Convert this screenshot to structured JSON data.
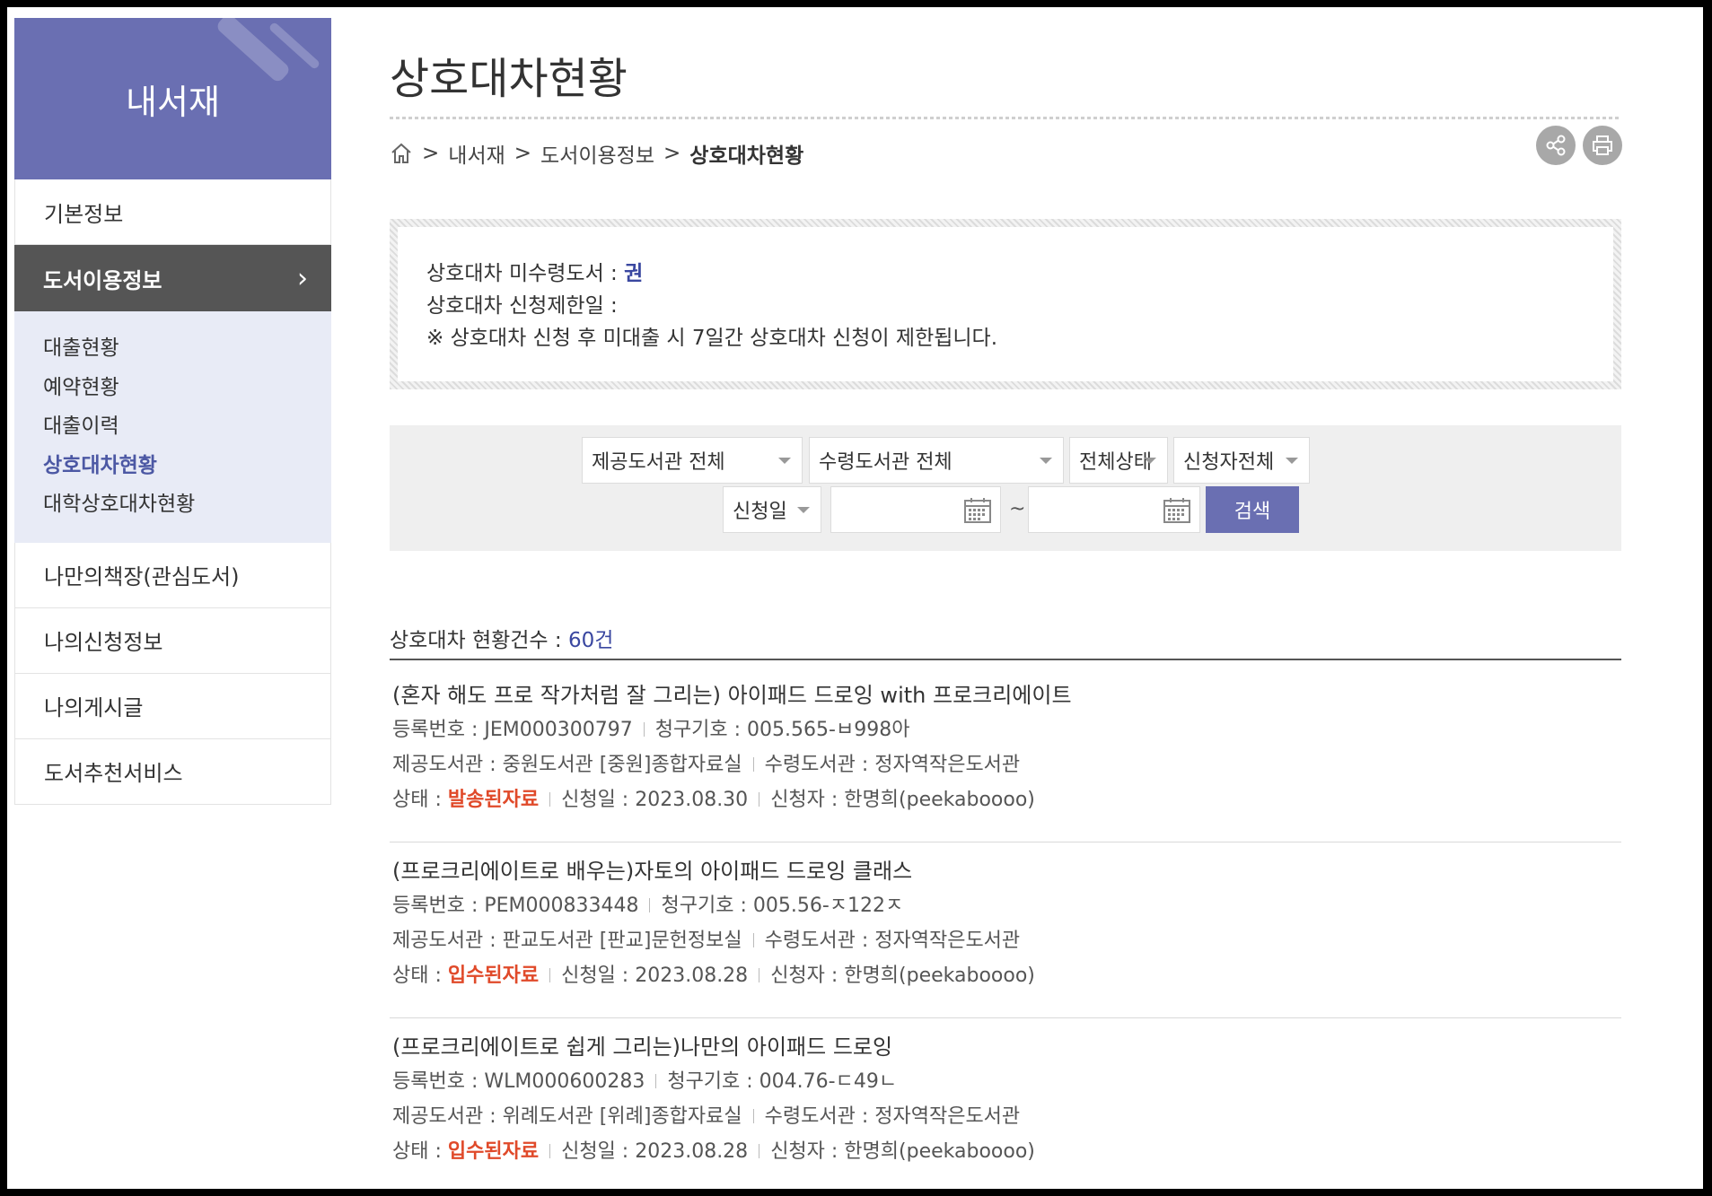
{
  "sidebar": {
    "title": "내서재",
    "items_top": [
      "기본정보"
    ],
    "active": "도서이용정보",
    "active_arrow": "›",
    "submenu": [
      "대출현황",
      "예약현황",
      "대출이력",
      "상호대차현황",
      "대학상호대차현황"
    ],
    "items_bottom": [
      "나만의책장(관심도서)",
      "나의신청정보",
      "나의게시글",
      "도서추천서비스"
    ]
  },
  "page": {
    "title": "상호대차현황",
    "breadcrumb": [
      "내서재",
      "도서이용정보",
      "상호대차현황"
    ],
    "breadcrumb_sep": ">"
  },
  "info": {
    "line1_label": "상호대차 미수령도서 : ",
    "line1_value": "권",
    "line2": "상호대차 신청제한일 :",
    "line3": "※ 상호대차 신청 후 미대출 시 7일간 상호대차 신청이 제한됩니다."
  },
  "search": {
    "provider_lib": "제공도서관 전체",
    "receiver_lib": "수령도서관 전체",
    "status": "전체상태",
    "applicant": "신청자전체",
    "date_type": "신청일",
    "date_from": "",
    "date_to": "",
    "tilde": "~",
    "button": "검색"
  },
  "count": {
    "label": "상호대차 현황건수 : ",
    "value": "60건"
  },
  "records": [
    {
      "title": "(혼자 해도 프로 작가처럼 잘 그리는) 아이패드 드로잉 with 프로크리에이트",
      "reg_no": "등록번호 : JEM000300797",
      "call_no": "청구기호 : 005.565-ㅂ998아",
      "provider": "제공도서관 : 중원도서관 [중원]종합자료실",
      "receiver": "수령도서관 : 정자역작은도서관",
      "status_label": "상태 : ",
      "status": "발송된자료",
      "date": "신청일 : 2023.08.30",
      "applicant": "신청자 : 한명희(peekaboooo)"
    },
    {
      "title": "(프로크리에이트로 배우는)자토의 아이패드 드로잉 클래스",
      "reg_no": "등록번호 : PEM000833448",
      "call_no": "청구기호 : 005.56-ㅈ122ㅈ",
      "provider": "제공도서관 : 판교도서관 [판교]문헌정보실",
      "receiver": "수령도서관 : 정자역작은도서관",
      "status_label": "상태 : ",
      "status": "입수된자료",
      "date": "신청일 : 2023.08.28",
      "applicant": "신청자 : 한명희(peekaboooo)"
    },
    {
      "title": "(프로크리에이트로 쉽게 그리는)나만의 아이패드 드로잉",
      "reg_no": "등록번호 : WLM000600283",
      "call_no": "청구기호 : 004.76-ㄷ49ㄴ",
      "provider": "제공도서관 : 위례도서관 [위례]종합자료실",
      "receiver": "수령도서관 : 정자역작은도서관",
      "status_label": "상태 : ",
      "status": "입수된자료",
      "date": "신청일 : 2023.08.28",
      "applicant": "신청자 : 한명희(peekaboooo)"
    }
  ]
}
